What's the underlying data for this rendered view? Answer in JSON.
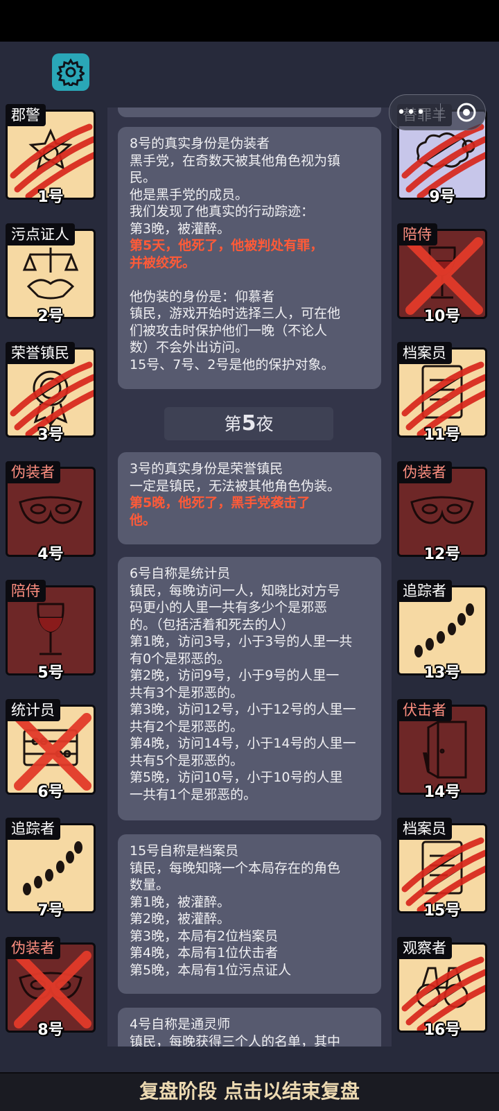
{
  "players": [
    {
      "number": "1号",
      "role": "郡警",
      "side": "good",
      "icon": "sheriff-badge-icon",
      "mark": "scratch"
    },
    {
      "number": "2号",
      "role": "污点证人",
      "side": "good",
      "icon": "scales-handshake-icon",
      "mark": "none"
    },
    {
      "number": "3号",
      "role": "荣誉镇民",
      "side": "good",
      "icon": "medal-icon",
      "mark": "scratch"
    },
    {
      "number": "4号",
      "role": "伪装者",
      "side": "evil",
      "icon": "mask-icon",
      "mark": "none"
    },
    {
      "number": "5号",
      "role": "陪侍",
      "side": "evil",
      "icon": "wine-glass-icon",
      "mark": "none"
    },
    {
      "number": "6号",
      "role": "统计员",
      "side": "good",
      "icon": "abacus-icon",
      "mark": "cross"
    },
    {
      "number": "7号",
      "role": "追踪者",
      "side": "good",
      "icon": "footprints-icon",
      "mark": "none"
    },
    {
      "number": "8号",
      "role": "伪装者",
      "side": "evil",
      "icon": "mask-icon",
      "mark": "cross"
    },
    {
      "number": "9号",
      "role": "替罪羊",
      "side": "lav",
      "icon": "sheep-icon",
      "mark": "scratch"
    },
    {
      "number": "10号",
      "role": "陪侍",
      "side": "evil",
      "icon": "wine-glass-icon",
      "mark": "cross"
    },
    {
      "number": "11号",
      "role": "档案员",
      "side": "good",
      "icon": "document-icon",
      "mark": "scratch"
    },
    {
      "number": "12号",
      "role": "伪装者",
      "side": "evil",
      "icon": "mask-icon",
      "mark": "none"
    },
    {
      "number": "13号",
      "role": "追踪者",
      "side": "good",
      "icon": "footprints-icon",
      "mark": "none"
    },
    {
      "number": "14号",
      "role": "伏击者",
      "side": "evil",
      "icon": "door-knife-icon",
      "mark": "none"
    },
    {
      "number": "15号",
      "role": "档案员",
      "side": "good",
      "icon": "document-icon",
      "mark": "scratch"
    },
    {
      "number": "16号",
      "role": "观察者",
      "side": "good",
      "icon": "binoculars-icon",
      "mark": "scratch"
    }
  ],
  "log": {
    "entry1": [
      "8号的真实身份是伪装者",
      "黑手党，在奇数天被其他角色视为镇",
      "民。",
      "他是黑手党的成员。",
      "我们发现了他真实的行动踪迹：",
      "第3晚，被灌醉。",
      "第5天，他死了，他被判处有罪，",
      "并被绞死。",
      "他伪装的身份是：仰慕者",
      "镇民，游戏开始时选择三人，可在他",
      "们被攻击时保护他们一晚（不论人",
      "数）不会外出访问。",
      "15号、7号、2号是他的保护对象。"
    ],
    "night_prefix": "第",
    "night_number": "5",
    "night_suffix": "夜",
    "entry2": [
      "3号的真实身份是荣誉镇民",
      "一定是镇民，无法被其他角色伪装。",
      "第5晚，他死了，黑手党袭击了",
      "他。"
    ],
    "entry3": [
      "6号自称是统计员",
      "镇民，每晚访问一人，知晓比对方号",
      "码更小的人里一共有多少个是邪恶",
      "的。（包括活着和死去的人）",
      "第1晚，访问3号，小于3号的人里一共",
      "有0个是邪恶的。",
      "第2晚，访问9号，小于9号的人里一",
      "共有3个是邪恶的。",
      "第3晚，访问12号，小于12号的人里一",
      "共有2个是邪恶的。",
      "第4晚，访问14号，小于14号的人里一",
      "共有5个是邪恶的。",
      "第5晚，访问10号，小于10号的人里",
      "一共有1个是邪恶的。"
    ],
    "entry4": [
      "15号自称是档案员",
      "镇民，每晚知晓一个本局存在的角色",
      "数量。",
      "第1晚，被灌醉。",
      "第2晚，被灌醉。",
      "第3晚，本局有2位档案员",
      "第4晚，本局有1位伏击者",
      "第5晚，本局有1位污点证人"
    ],
    "entry5": [
      "4号自称是通灵师",
      "镇民，每晚获得三个人的名单，其中"
    ]
  },
  "footer": "复盘阶段 点击以结束复盘",
  "colors": {
    "background": "#272a3b",
    "good_card": "#f6d9a3",
    "evil_card": "#6e2727",
    "evil_role_text": "#ff8f80",
    "death_text": "#ff5a38",
    "settings_button": "#2aa7b7"
  }
}
